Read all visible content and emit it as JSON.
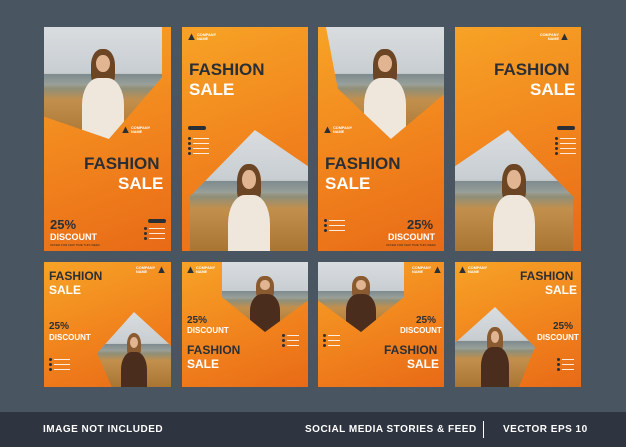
{
  "design": {
    "headline_1": "FASHION",
    "headline_2": "SALE",
    "discount_value": "25%",
    "discount_label": "DISCOUNT",
    "offer_note": "OFFER FOR FEW TIME THIS WEEK",
    "company_name": "COMPANY NAME"
  },
  "footer": {
    "left_text": "IMAGE NOT INCLUDED",
    "middle_text": "SOCIAL MEDIA STORIES & FEED",
    "right_text": "VECTOR EPS 10"
  },
  "colors": {
    "background": "#4a5562",
    "footer_bar": "#2e3440",
    "orange_light": "#f7a326",
    "orange_dark": "#e86a17",
    "text_dark": "#2a2f36",
    "text_light": "#ffffff"
  },
  "icons": [
    "company-logo-icon",
    "phone-icon",
    "email-icon",
    "web-icon",
    "location-icon"
  ]
}
